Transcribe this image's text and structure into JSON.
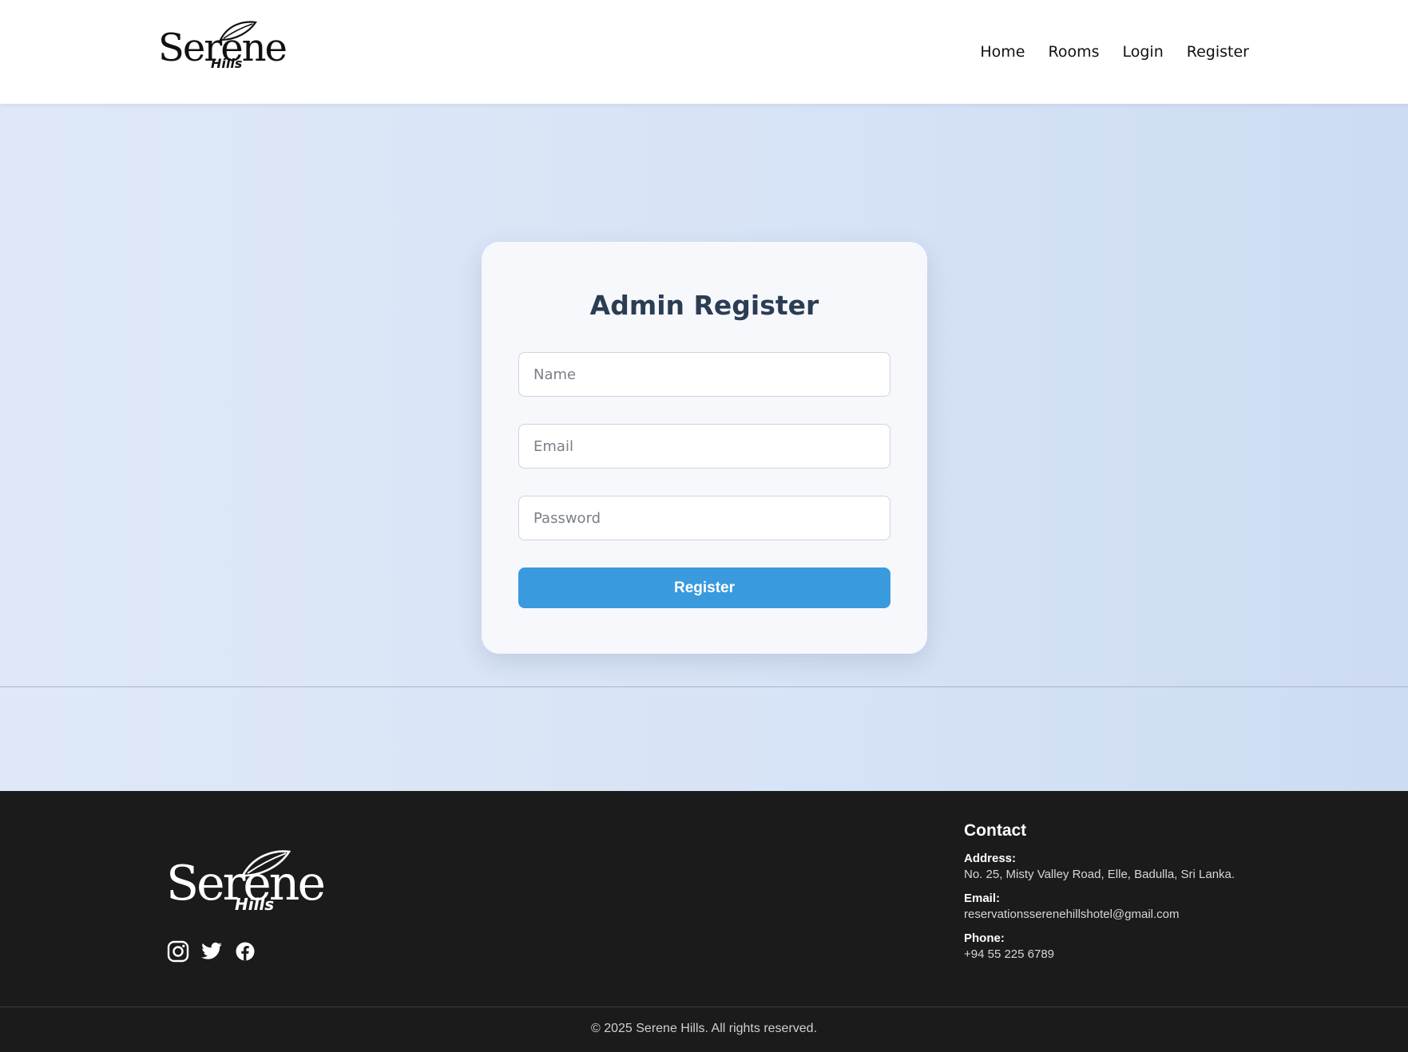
{
  "header": {
    "logo": {
      "main": "Serene",
      "sub": "Hills"
    },
    "nav": [
      "Home",
      "Rooms",
      "Login",
      "Register"
    ]
  },
  "form": {
    "title": "Admin Register",
    "name_placeholder": "Name",
    "email_placeholder": "Email",
    "password_placeholder": "Password",
    "submit_label": "Register"
  },
  "footer": {
    "logo": {
      "main": "Serene",
      "sub": "Hills"
    },
    "socials": [
      "instagram-icon",
      "twitter-icon",
      "facebook-icon"
    ],
    "contact": {
      "heading": "Contact",
      "address_label": "Address:",
      "address": "No. 25, Misty Valley Road, Elle, Badulla, Sri Lanka.",
      "email_label": "Email:",
      "email": "reservationsserenehillshotel@gmail.com",
      "phone_label": "Phone:",
      "phone": "+94 55 225 6789"
    },
    "copyright": "© 2025 Serene Hills. All rights reserved."
  },
  "colors": {
    "accent": "#3a9ade",
    "title": "#2b3d52",
    "footer_bg": "#1b1b1b"
  }
}
